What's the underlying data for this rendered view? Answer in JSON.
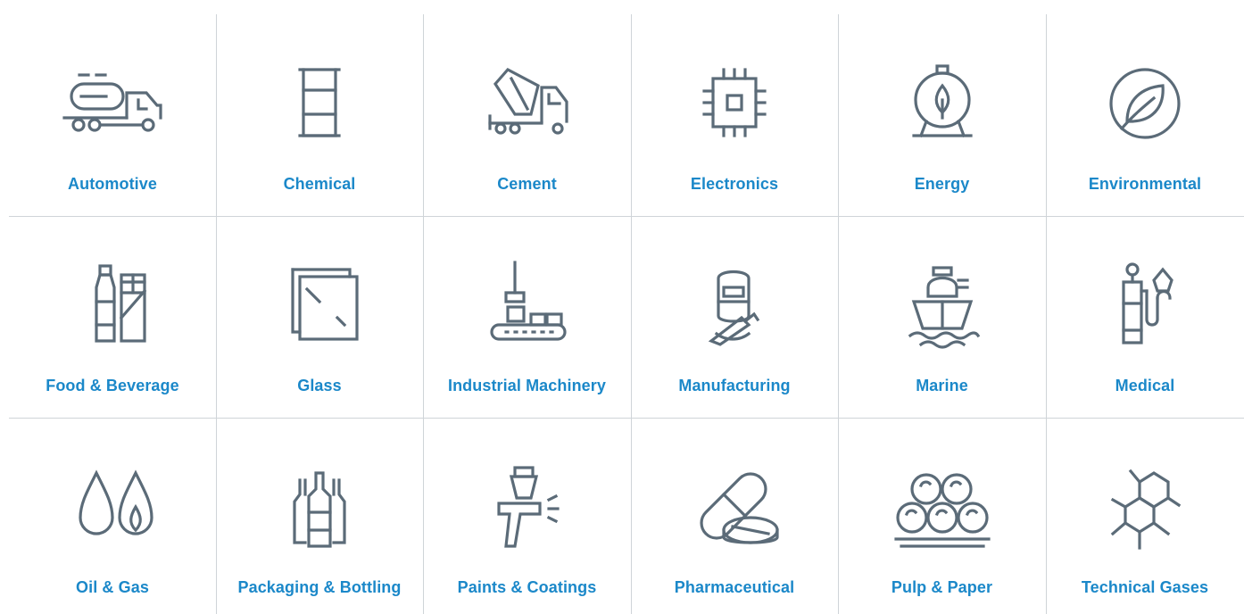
{
  "industries": [
    {
      "label": "Automotive",
      "icon": "tanker-truck-icon"
    },
    {
      "label": "Chemical",
      "icon": "barrel-icon"
    },
    {
      "label": "Cement",
      "icon": "cement-mixer-icon"
    },
    {
      "label": "Electronics",
      "icon": "microchip-icon"
    },
    {
      "label": "Energy",
      "icon": "energy-tank-icon"
    },
    {
      "label": "Environmental",
      "icon": "leaf-circle-icon"
    },
    {
      "label": "Food & Beverage",
      "icon": "bottle-carton-icon"
    },
    {
      "label": "Glass",
      "icon": "glass-pane-icon"
    },
    {
      "label": "Industrial Machinery",
      "icon": "conveyor-robot-icon"
    },
    {
      "label": "Manufacturing",
      "icon": "welder-icon"
    },
    {
      "label": "Marine",
      "icon": "ship-icon"
    },
    {
      "label": "Medical",
      "icon": "oxygen-mask-icon"
    },
    {
      "label": "Oil & Gas",
      "icon": "drops-flame-icon"
    },
    {
      "label": "Packaging & Bottling",
      "icon": "bottles-icon"
    },
    {
      "label": "Paints & Coatings",
      "icon": "spray-gun-icon"
    },
    {
      "label": "Pharmaceutical",
      "icon": "pills-icon"
    },
    {
      "label": "Pulp & Paper",
      "icon": "paper-rolls-icon"
    },
    {
      "label": "Technical Gases",
      "icon": "molecule-icon"
    }
  ],
  "colors": {
    "label": "#1b88c9",
    "icon_stroke": "#5b6b78",
    "divider": "#cfd4d8"
  }
}
